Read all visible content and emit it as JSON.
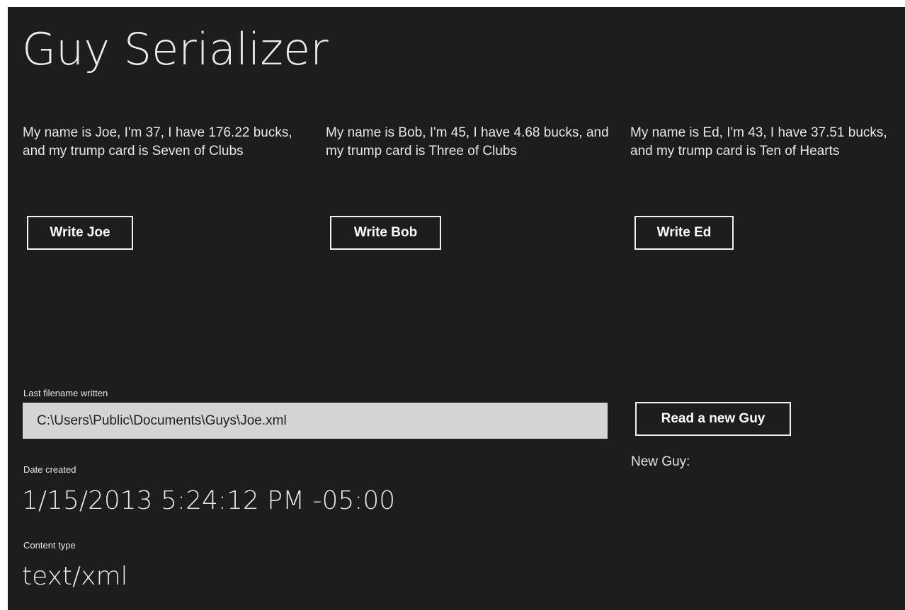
{
  "app": {
    "title": "Guy Serializer"
  },
  "guys": [
    {
      "description": "My name is Joe, I'm 37, I have 176.22 bucks, and my trump card is Seven of Clubs",
      "button_label": "Write Joe"
    },
    {
      "description": "My name is Bob, I'm 45, I have 4.68 bucks, and my trump card is Three of Clubs",
      "button_label": "Write Bob"
    },
    {
      "description": "My name is Ed, I'm 43, I have 37.51 bucks, and my trump card is Ten of Hearts",
      "button_label": "Write Ed"
    }
  ],
  "file": {
    "filename_label": "Last filename written",
    "filename_value": "C:\\Users\\Public\\Documents\\Guys\\Joe.xml",
    "date_label": "Date created",
    "date_value": "1/15/2013 5:24:12 PM -05:00",
    "content_type_label": "Content type",
    "content_type_value": "text/xml"
  },
  "reader": {
    "button_label": "Read a new Guy",
    "new_guy_label": "New Guy:"
  },
  "colors": {
    "background": "#1d1d1d",
    "text": "#e6e6e6",
    "textbox": "#d4d4d4"
  }
}
